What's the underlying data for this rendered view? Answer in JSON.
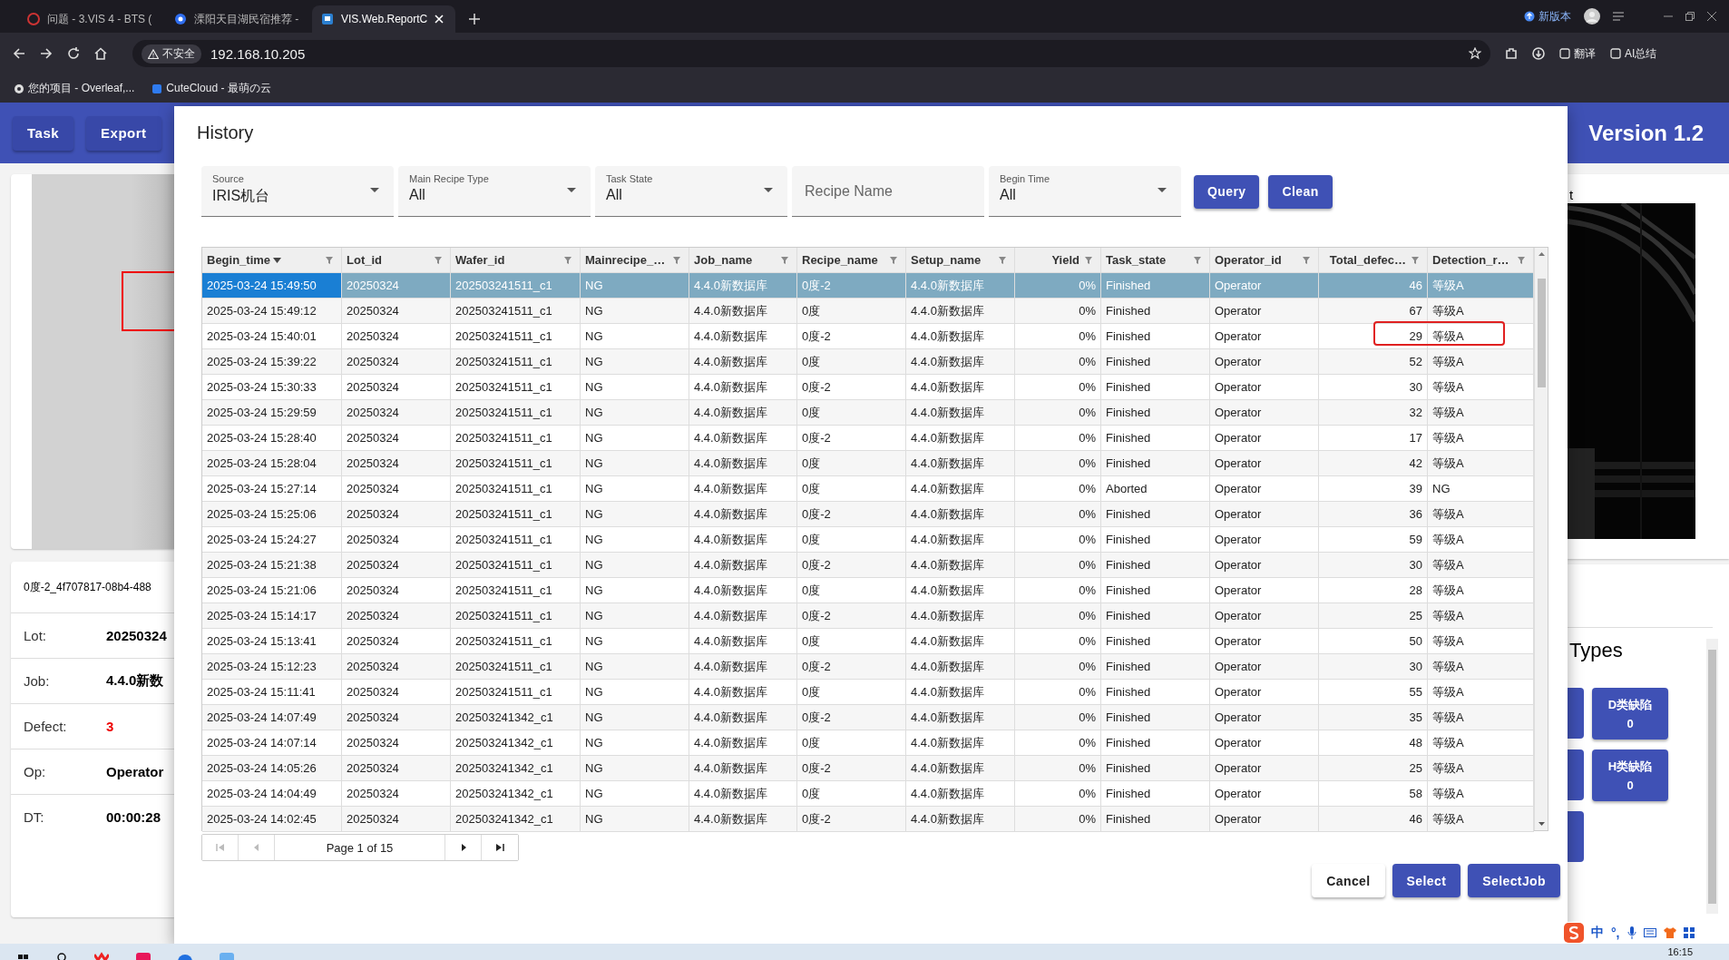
{
  "browser": {
    "tabs": [
      {
        "title": "问题 - 3.VIS 4 - BTS (",
        "selected": false
      },
      {
        "title": "溧阳天目湖民宿推荐 -",
        "selected": false
      },
      {
        "title": "VIS.Web.ReportC",
        "selected": true
      }
    ],
    "new_version": "新版本",
    "address": {
      "security": "不安全",
      "url": "192.168.10.205"
    },
    "toolbar_labels": [
      "翻译",
      "AI总结"
    ],
    "bookmarks": [
      "您的项目 - Overleaf,...",
      "CuteCloud - 最萌の云"
    ]
  },
  "app": {
    "header_buttons": [
      "Task",
      "Export"
    ],
    "version": "Version 1.2",
    "caption": "0度-2_4f707817-08b4-488",
    "fields": [
      {
        "label": "Lot:",
        "value": "20250324",
        "kind": "normal"
      },
      {
        "label": "Job:",
        "value": "4.4.0新数",
        "kind": "normal"
      },
      {
        "label": "Defect:",
        "value": "3",
        "kind": "alert"
      },
      {
        "label": "Op:",
        "value": "Operator",
        "kind": "normal"
      },
      {
        "label": "DT:",
        "value": "00:00:28",
        "kind": "normal"
      }
    ],
    "image_title": "t",
    "types_title": "Types",
    "type_buttons": [
      {
        "label": "D类缺陷",
        "count": "0"
      },
      {
        "label": "H类缺陷",
        "count": "0"
      }
    ]
  },
  "dialog": {
    "title": "History",
    "filters": [
      {
        "kind": "select",
        "label": "Source",
        "value": "IRIS机台"
      },
      {
        "kind": "select",
        "label": "Main Recipe Type",
        "value": "All"
      },
      {
        "kind": "select",
        "label": "Task State",
        "value": "All"
      },
      {
        "kind": "text",
        "placeholder": "Recipe Name"
      },
      {
        "kind": "select",
        "label": "Begin Time",
        "value": "All"
      }
    ],
    "filter_buttons": [
      "Query",
      "Clean"
    ],
    "table": {
      "columns": [
        {
          "label": "Begin_time",
          "numeric": false,
          "sorted": true
        },
        {
          "label": "Lot_id",
          "numeric": false,
          "sorted": false
        },
        {
          "label": "Wafer_id",
          "numeric": false,
          "sorted": false
        },
        {
          "label": "Mainrecipe_…",
          "numeric": false,
          "sorted": false
        },
        {
          "label": "Job_name",
          "numeric": false,
          "sorted": false
        },
        {
          "label": "Recipe_name",
          "numeric": false,
          "sorted": false
        },
        {
          "label": "Setup_name",
          "numeric": false,
          "sorted": false
        },
        {
          "label": "Yield",
          "numeric": true,
          "sorted": false
        },
        {
          "label": "Task_state",
          "numeric": false,
          "sorted": false
        },
        {
          "label": "Operator_id",
          "numeric": false,
          "sorted": false
        },
        {
          "label": "Total_defec…",
          "numeric": true,
          "sorted": false
        },
        {
          "label": "Detection_r…",
          "numeric": false,
          "sorted": false
        }
      ],
      "rows": [
        {
          "selected": true,
          "marked": false,
          "cells": [
            "2025-03-24 15:49:50",
            "20250324",
            "202503241511_c1",
            "NG",
            "4.4.0新数据库",
            "0度-2",
            "4.4.0新数据库",
            "0%",
            "Finished",
            "Operator",
            "46",
            "等级A"
          ]
        },
        {
          "selected": false,
          "marked": false,
          "cells": [
            "2025-03-24 15:49:12",
            "20250324",
            "202503241511_c1",
            "NG",
            "4.4.0新数据库",
            "0度",
            "4.4.0新数据库",
            "0%",
            "Finished",
            "Operator",
            "67",
            "等级A"
          ]
        },
        {
          "selected": false,
          "marked": true,
          "cells": [
            "2025-03-24 15:40:01",
            "20250324",
            "202503241511_c1",
            "NG",
            "4.4.0新数据库",
            "0度-2",
            "4.4.0新数据库",
            "0%",
            "Finished",
            "Operator",
            "29",
            "等级A"
          ]
        },
        {
          "selected": false,
          "marked": false,
          "cells": [
            "2025-03-24 15:39:22",
            "20250324",
            "202503241511_c1",
            "NG",
            "4.4.0新数据库",
            "0度",
            "4.4.0新数据库",
            "0%",
            "Finished",
            "Operator",
            "52",
            "等级A"
          ]
        },
        {
          "selected": false,
          "marked": false,
          "cells": [
            "2025-03-24 15:30:33",
            "20250324",
            "202503241511_c1",
            "NG",
            "4.4.0新数据库",
            "0度-2",
            "4.4.0新数据库",
            "0%",
            "Finished",
            "Operator",
            "30",
            "等级A"
          ]
        },
        {
          "selected": false,
          "marked": false,
          "cells": [
            "2025-03-24 15:29:59",
            "20250324",
            "202503241511_c1",
            "NG",
            "4.4.0新数据库",
            "0度",
            "4.4.0新数据库",
            "0%",
            "Finished",
            "Operator",
            "32",
            "等级A"
          ]
        },
        {
          "selected": false,
          "marked": false,
          "cells": [
            "2025-03-24 15:28:40",
            "20250324",
            "202503241511_c1",
            "NG",
            "4.4.0新数据库",
            "0度-2",
            "4.4.0新数据库",
            "0%",
            "Finished",
            "Operator",
            "17",
            "等级A"
          ]
        },
        {
          "selected": false,
          "marked": false,
          "cells": [
            "2025-03-24 15:28:04",
            "20250324",
            "202503241511_c1",
            "NG",
            "4.4.0新数据库",
            "0度",
            "4.4.0新数据库",
            "0%",
            "Finished",
            "Operator",
            "42",
            "等级A"
          ]
        },
        {
          "selected": false,
          "marked": false,
          "cells": [
            "2025-03-24 15:27:14",
            "20250324",
            "202503241511_c1",
            "NG",
            "4.4.0新数据库",
            "0度",
            "4.4.0新数据库",
            "0%",
            "Aborted",
            "Operator",
            "39",
            "NG"
          ]
        },
        {
          "selected": false,
          "marked": false,
          "cells": [
            "2025-03-24 15:25:06",
            "20250324",
            "202503241511_c1",
            "NG",
            "4.4.0新数据库",
            "0度-2",
            "4.4.0新数据库",
            "0%",
            "Finished",
            "Operator",
            "36",
            "等级A"
          ]
        },
        {
          "selected": false,
          "marked": false,
          "cells": [
            "2025-03-24 15:24:27",
            "20250324",
            "202503241511_c1",
            "NG",
            "4.4.0新数据库",
            "0度",
            "4.4.0新数据库",
            "0%",
            "Finished",
            "Operator",
            "59",
            "等级A"
          ]
        },
        {
          "selected": false,
          "marked": false,
          "cells": [
            "2025-03-24 15:21:38",
            "20250324",
            "202503241511_c1",
            "NG",
            "4.4.0新数据库",
            "0度-2",
            "4.4.0新数据库",
            "0%",
            "Finished",
            "Operator",
            "30",
            "等级A"
          ]
        },
        {
          "selected": false,
          "marked": false,
          "cells": [
            "2025-03-24 15:21:06",
            "20250324",
            "202503241511_c1",
            "NG",
            "4.4.0新数据库",
            "0度",
            "4.4.0新数据库",
            "0%",
            "Finished",
            "Operator",
            "28",
            "等级A"
          ]
        },
        {
          "selected": false,
          "marked": false,
          "cells": [
            "2025-03-24 15:14:17",
            "20250324",
            "202503241511_c1",
            "NG",
            "4.4.0新数据库",
            "0度-2",
            "4.4.0新数据库",
            "0%",
            "Finished",
            "Operator",
            "25",
            "等级A"
          ]
        },
        {
          "selected": false,
          "marked": false,
          "cells": [
            "2025-03-24 15:13:41",
            "20250324",
            "202503241511_c1",
            "NG",
            "4.4.0新数据库",
            "0度",
            "4.4.0新数据库",
            "0%",
            "Finished",
            "Operator",
            "50",
            "等级A"
          ]
        },
        {
          "selected": false,
          "marked": false,
          "cells": [
            "2025-03-24 15:12:23",
            "20250324",
            "202503241511_c1",
            "NG",
            "4.4.0新数据库",
            "0度-2",
            "4.4.0新数据库",
            "0%",
            "Finished",
            "Operator",
            "30",
            "等级A"
          ]
        },
        {
          "selected": false,
          "marked": false,
          "cells": [
            "2025-03-24 15:11:41",
            "20250324",
            "202503241511_c1",
            "NG",
            "4.4.0新数据库",
            "0度",
            "4.4.0新数据库",
            "0%",
            "Finished",
            "Operator",
            "55",
            "等级A"
          ]
        },
        {
          "selected": false,
          "marked": false,
          "cells": [
            "2025-03-24 14:07:49",
            "20250324",
            "202503241342_c1",
            "NG",
            "4.4.0新数据库",
            "0度-2",
            "4.4.0新数据库",
            "0%",
            "Finished",
            "Operator",
            "35",
            "等级A"
          ]
        },
        {
          "selected": false,
          "marked": false,
          "cells": [
            "2025-03-24 14:07:14",
            "20250324",
            "202503241342_c1",
            "NG",
            "4.4.0新数据库",
            "0度",
            "4.4.0新数据库",
            "0%",
            "Finished",
            "Operator",
            "48",
            "等级A"
          ]
        },
        {
          "selected": false,
          "marked": false,
          "cells": [
            "2025-03-24 14:05:26",
            "20250324",
            "202503241342_c1",
            "NG",
            "4.4.0新数据库",
            "0度-2",
            "4.4.0新数据库",
            "0%",
            "Finished",
            "Operator",
            "25",
            "等级A"
          ]
        },
        {
          "selected": false,
          "marked": false,
          "cells": [
            "2025-03-24 14:04:49",
            "20250324",
            "202503241342_c1",
            "NG",
            "4.4.0新数据库",
            "0度",
            "4.4.0新数据库",
            "0%",
            "Finished",
            "Operator",
            "58",
            "等级A"
          ]
        },
        {
          "selected": false,
          "marked": false,
          "cells": [
            "2025-03-24 14:02:45",
            "20250324",
            "202503241342_c1",
            "NG",
            "4.4.0新数据库",
            "0度-2",
            "4.4.0新数据库",
            "0%",
            "Finished",
            "Operator",
            "46",
            "等级A"
          ]
        }
      ]
    },
    "pagination": {
      "text": "Page 1 of 15"
    },
    "actions": [
      {
        "label": "Cancel",
        "kind": "plain"
      },
      {
        "label": "Select",
        "kind": "primary"
      },
      {
        "label": "SelectJob",
        "kind": "primary"
      }
    ]
  },
  "ime": {
    "mode": "中",
    "punct": "°,"
  },
  "taskbar": {
    "clock": "16:15"
  }
}
